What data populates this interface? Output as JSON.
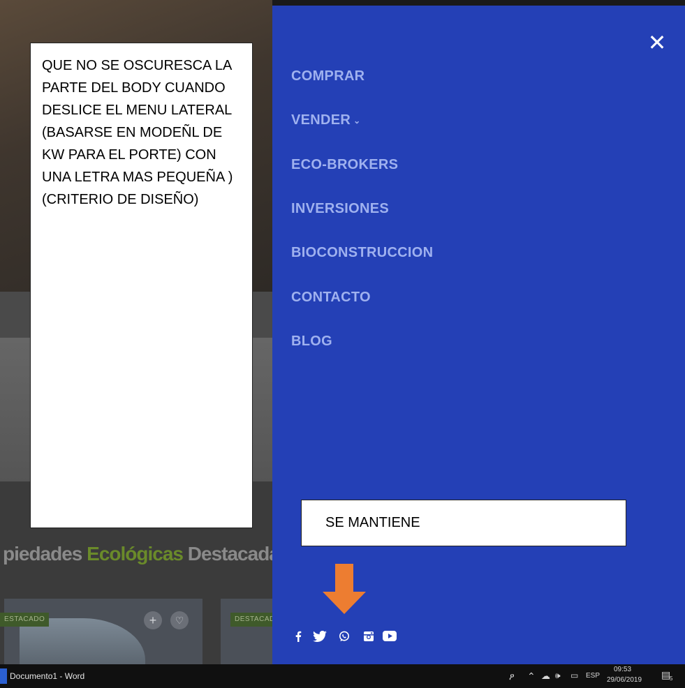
{
  "notes": {
    "left_text": "QUE NO SE OSCURESCA LA PARTE DEL BODY CUANDO DESLICE EL MENU LATERAL (BASARSE EN MODEÑL DE KW PARA EL PORTE) CON UNA LETRA MAS PEQUEÑA ) (CRITERIO DE DISEÑO)",
    "right_text": "SE MANTIENE"
  },
  "background": {
    "heading_part1": "piedades ",
    "heading_part2": "Ecológicas",
    "heading_part3": " Destacadas",
    "badge1": "ESTACADO",
    "badge2": "DESTACAD"
  },
  "menu": {
    "items": [
      {
        "label": "COMPRAR"
      },
      {
        "label": "VENDER",
        "chevron": "⌄"
      },
      {
        "label": "ECO-BROKERS"
      },
      {
        "label": "INVERSIONES"
      },
      {
        "label": "BIOCONSTRUCCION"
      },
      {
        "label": "CONTACTO"
      },
      {
        "label": "BLOG"
      }
    ],
    "close_glyph": "✕",
    "social_icons": [
      "facebook-icon",
      "twitter-icon",
      "whatsapp-icon",
      "instagram-icon",
      "youtube-icon"
    ]
  },
  "taskbar": {
    "app_label": "Documento1 - Word",
    "language": "ESP",
    "time": "09:53",
    "date": "29/06/2019",
    "notification_count": "5"
  },
  "colors": {
    "panel": "#2440b6",
    "menu_text": "#9fb1ef",
    "arrow": "#ed7d31",
    "accent_green": "#6a8a2a"
  }
}
